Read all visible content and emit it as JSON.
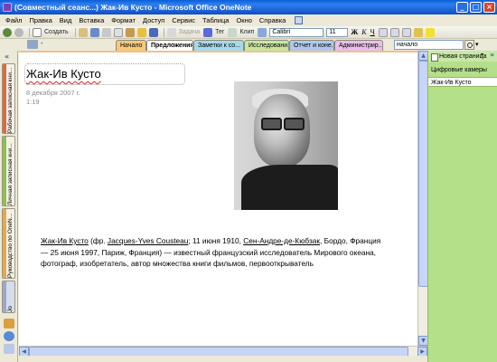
{
  "window": {
    "title": "(Совместный сеанс...) Жак-Ив Кусто - Microsoft Office OneNote",
    "minimize": "_",
    "maximize": "□",
    "close": "×"
  },
  "menu": [
    "Файл",
    "Правка",
    "Вид",
    "Вставка",
    "Формат",
    "Доступ",
    "Сервис",
    "Таблица",
    "Окно",
    "Справка"
  ],
  "toolbar": {
    "create_label": "Создать",
    "task_label": "Задача",
    "tag_label": "Тег",
    "clip_label": "Клип",
    "font_name": "Calibri",
    "font_size": "11",
    "bold": "Ж",
    "italic": "К",
    "underline": "Ч"
  },
  "tabs": [
    {
      "label": "Начало",
      "color": "#f5c97a"
    },
    {
      "label": "Предложения",
      "color": "#ffffff"
    },
    {
      "label": "Заметки к со...",
      "color": "#a8d8ea"
    },
    {
      "label": "Исследовани...",
      "color": "#c8e6a0"
    },
    {
      "label": "Отчет и коне...",
      "color": "#b0c8ec"
    },
    {
      "label": "Администрир...",
      "color": "#e8c0e8"
    }
  ],
  "search": {
    "value": "начало"
  },
  "notebook_dash": "-",
  "left_nav": {
    "notebooks": [
      {
        "label": "Рабочая записная кни...",
        "color": "#e06a3a"
      },
      {
        "label": "Личная записная кни...",
        "color": "#8bc34a"
      },
      {
        "label": "Руководство по OneN...",
        "color": "#e8a84a"
      },
      {
        "label": "Jo",
        "color": "#9aa8c8"
      }
    ]
  },
  "page": {
    "title": "Жак-Ив Кусто",
    "date": "8 декабря 2007 г.",
    "time": "1:19",
    "para": {
      "name": "Жак-Ив Кусто",
      "fr_open": " (фр. ",
      "fr_name": "Jacques-Yves Cousteau",
      "born": "; 11 июня 1910, ",
      "place1": "Сен-Андре-де-Кюбзак",
      "rest1": ", Бордо, Франция — 25 июня 1997,  Париж, Франция) — известный французский исследователь Мирового океана, фотограф, изобретатель, автор множества книги фильмов, первооткрыватель"
    }
  },
  "right_panel": {
    "new_page": "Новая страница",
    "pages": [
      "Цифровые камеры",
      "Жак-Ив Кусто"
    ],
    "active_index": 1
  }
}
